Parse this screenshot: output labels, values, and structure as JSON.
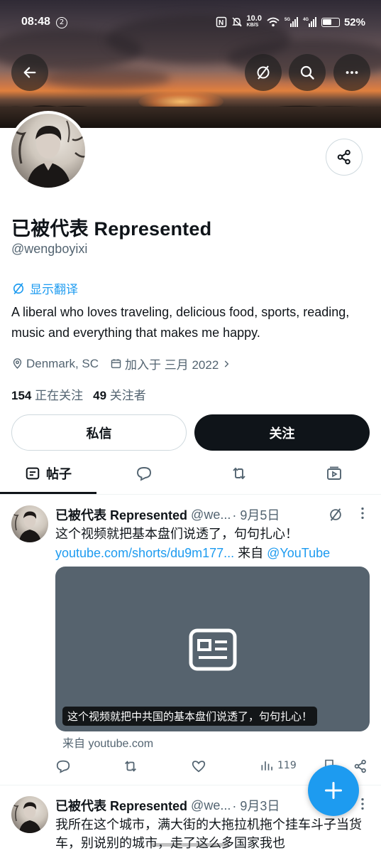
{
  "status_bar": {
    "time": "08:48",
    "notification_count": "2",
    "network_speed": "10.0",
    "network_speed_unit": "KB/S",
    "battery_percent": "52%"
  },
  "header": {
    "back_icon": "arrow-left-icon",
    "translate_icon": "grok-translate-icon",
    "search_icon": "search-icon",
    "more_icon": "more-horizontal-icon"
  },
  "profile": {
    "display_name": "已被代表 Represented",
    "handle": "@wengboyixi",
    "translate_label": "显示翻译",
    "bio": "A liberal who loves traveling, delicious food, sports, reading, music and everything that makes me happy.",
    "location": "Denmark, SC",
    "joined": "加入于 三月 2022",
    "following_count": "154",
    "following_label": "正在关注",
    "followers_count": "49",
    "followers_label": "关注者",
    "dm_button": "私信",
    "follow_button": "关注"
  },
  "tabs": [
    {
      "label": "帖子",
      "icon": "posts-icon",
      "active": true
    },
    {
      "label": "",
      "icon": "replies-icon",
      "active": false
    },
    {
      "label": "",
      "icon": "reposts-icon",
      "active": false
    },
    {
      "label": "",
      "icon": "media-icon",
      "active": false
    }
  ],
  "tweets": [
    {
      "name": "已被代表 Represented",
      "handle": "@we...",
      "date": "· 9月5日",
      "text": "这个视频就把基本盘们说透了，句句扎心！",
      "link": "youtube.com/shorts/du9m177...",
      "via": " 来自 ",
      "mention": "@YouTube",
      "card_caption": "这个视频就把中共国的基本盘们说透了，句句扎心！",
      "card_source": "来自 youtube.com",
      "views": "119"
    },
    {
      "name": "已被代表 Represented",
      "handle": "@we...",
      "date": "· 9月3日",
      "text": "我所在这个城市，满大街的大拖拉机拖个挂车斗子当货车，别说别的城市，走了这么多国家我也"
    }
  ],
  "colors": {
    "accent": "#1d9bf0",
    "text": "#0f1419",
    "muted": "#536471",
    "card_bg": "#56636e"
  }
}
